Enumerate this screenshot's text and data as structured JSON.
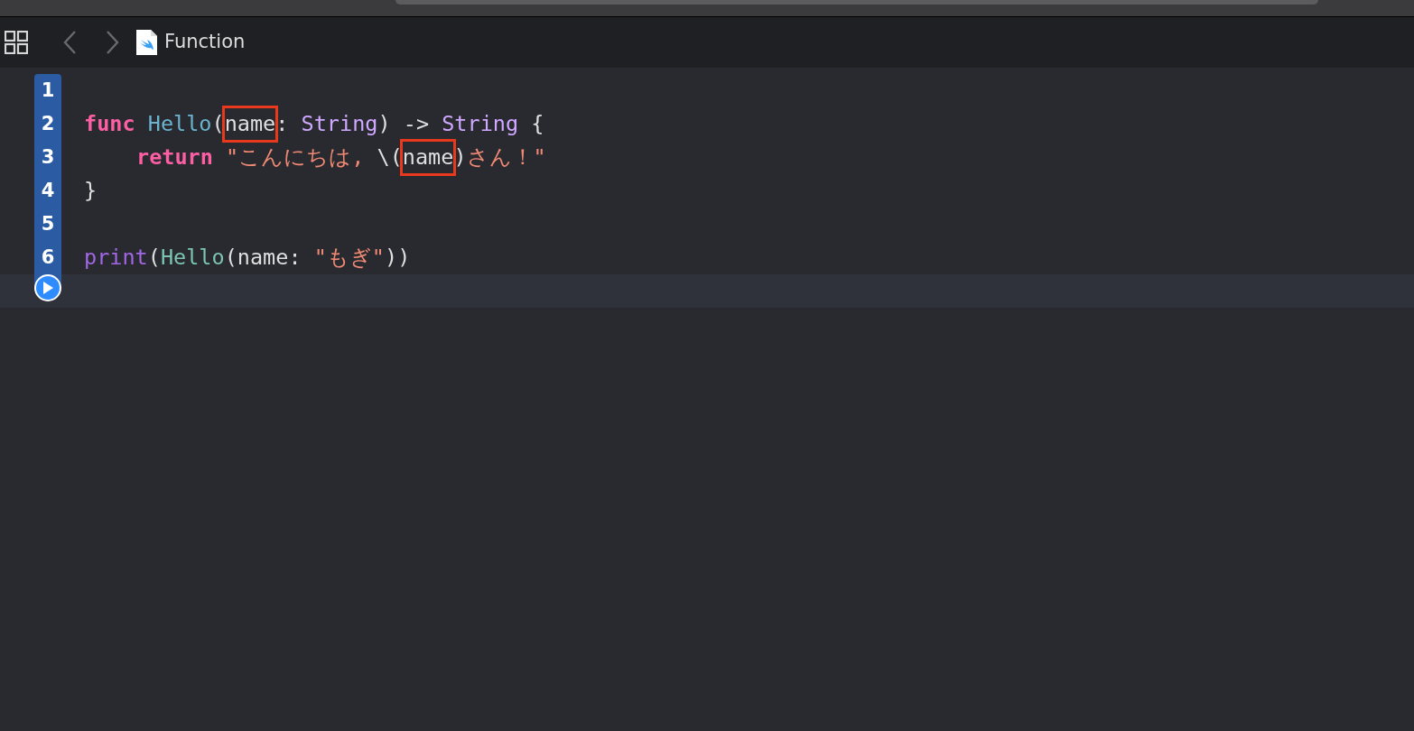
{
  "editor_tab": {
    "title": "Function"
  },
  "navigation": {
    "back_enabled": false,
    "forward_enabled": false
  },
  "lines": [
    {
      "number": "1"
    },
    {
      "number": "2",
      "tokens": [
        {
          "text": "func ",
          "kind": "keyword"
        },
        {
          "text": "Hello",
          "kind": "declaration"
        },
        {
          "text": "(",
          "kind": "plain"
        },
        {
          "text": "name",
          "kind": "plain",
          "boxed": true
        },
        {
          "text": ": ",
          "kind": "plain"
        },
        {
          "text": "String",
          "kind": "type"
        },
        {
          "text": ") -> ",
          "kind": "plain"
        },
        {
          "text": "String",
          "kind": "type"
        },
        {
          "text": " {",
          "kind": "plain"
        }
      ],
      "children": [
        {
          "number": "3",
          "tokens": [
            {
              "text": "return ",
              "kind": "keyword"
            },
            {
              "text": "\"こんにちは, ",
              "kind": "string"
            },
            {
              "text": "\\(",
              "kind": "plain"
            },
            {
              "text": "name",
              "kind": "plain",
              "boxed": true
            },
            {
              "text": ")",
              "kind": "plain"
            },
            {
              "text": "さん！\"",
              "kind": "string"
            }
          ]
        }
      ]
    },
    {
      "number": "4",
      "tokens": [
        {
          "text": "}",
          "kind": "plain"
        }
      ]
    },
    {
      "number": "5"
    },
    {
      "number": "6",
      "tokens": [
        {
          "text": "print",
          "kind": "call"
        },
        {
          "text": "(",
          "kind": "plain"
        },
        {
          "text": "Hello",
          "kind": "reference"
        },
        {
          "text": "(name: ",
          "kind": "plain"
        },
        {
          "text": "\"もぎ\"",
          "kind": "string"
        },
        {
          "text": "))",
          "kind": "plain"
        }
      ]
    },
    {
      "run_button": true,
      "current": true
    }
  ]
}
